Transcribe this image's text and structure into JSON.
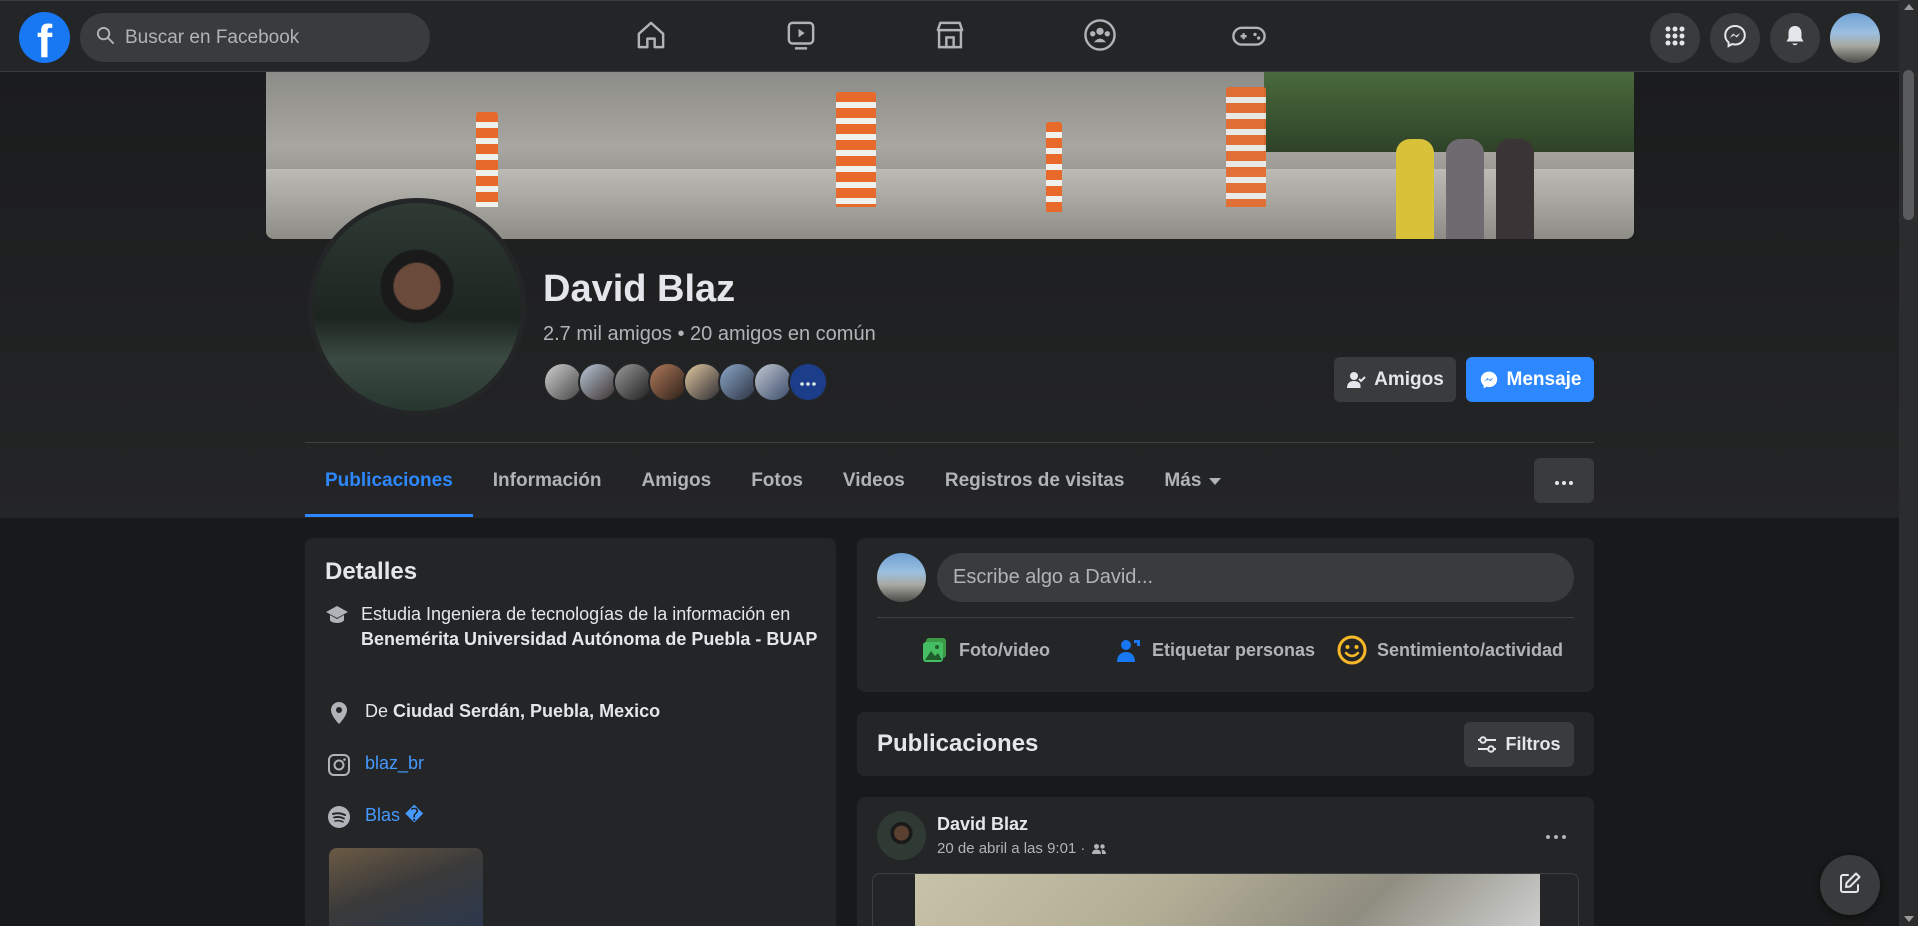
{
  "search": {
    "placeholder": "Buscar en Facebook"
  },
  "nav_icons": [
    "home-icon",
    "watch-icon",
    "marketplace-icon",
    "groups-icon",
    "gaming-icon"
  ],
  "profile": {
    "name": "David Blaz",
    "friends_count": "2.7 mil amigos • 20 amigos en común",
    "friends_button": "Amigos",
    "message_button": "Mensaje"
  },
  "tabs": [
    {
      "label": "Publicaciones",
      "active": true
    },
    {
      "label": "Información"
    },
    {
      "label": "Amigos"
    },
    {
      "label": "Fotos"
    },
    {
      "label": "Videos"
    },
    {
      "label": "Registros de visitas"
    },
    {
      "label": "Más"
    }
  ],
  "details": {
    "title": "Detalles",
    "study_prefix": "Estudia Ingeniera de tecnologías de la información en",
    "study_school": "Benemérita Universidad Autónoma de Puebla - BUAP",
    "from_prefix": "De",
    "from_place": "Ciudad Serdán, Puebla, Mexico",
    "instagram": "blaz_br",
    "spotify": "Blas �"
  },
  "composer": {
    "placeholder": "Escribe algo a David...",
    "photo_video": "Foto/video",
    "tag_people": "Etiquetar personas",
    "feeling": "Sentimiento/actividad"
  },
  "posts": {
    "title": "Publicaciones",
    "filters": "Filtros"
  },
  "post": {
    "author": "David Blaz",
    "timestamp": "20 de abril a las 9:01 ·"
  },
  "colors": {
    "accent": "#2d88ff",
    "background": "#18191a",
    "surface": "#242526"
  }
}
